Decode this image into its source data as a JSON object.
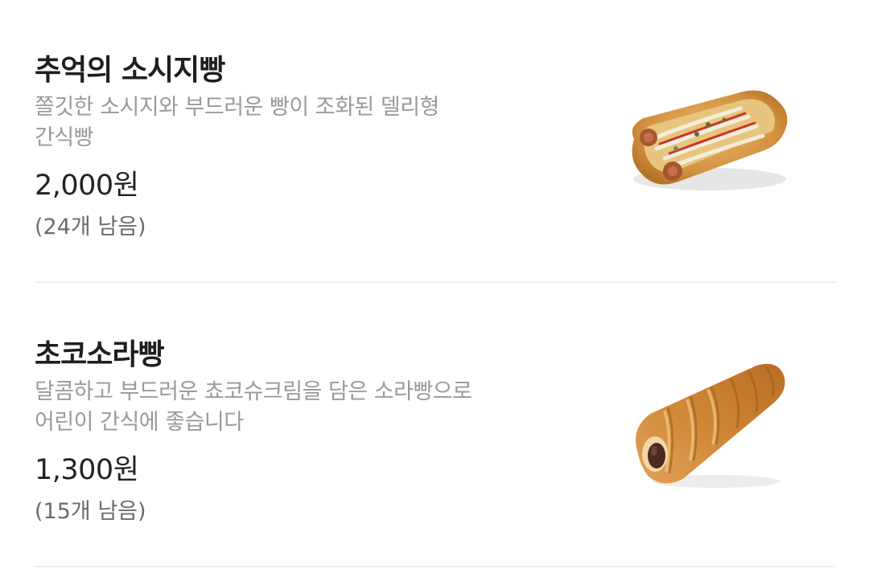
{
  "products": [
    {
      "name": "추억의 소시지빵",
      "description_line1": "쫄깃한 소시지와 부드러운 빵이 조화된 델리형",
      "description_line2": "간식빵",
      "price": "2,000원",
      "stock": "(24개 남음)"
    },
    {
      "name": "초코소라빵",
      "description_line1": "달콤하고 부드러운 쵸코슈크림을 담은 소라빵으로",
      "description_line2": "어린이 간식에 좋습니다",
      "price": "1,300원",
      "stock": "(15개 남음)"
    }
  ]
}
